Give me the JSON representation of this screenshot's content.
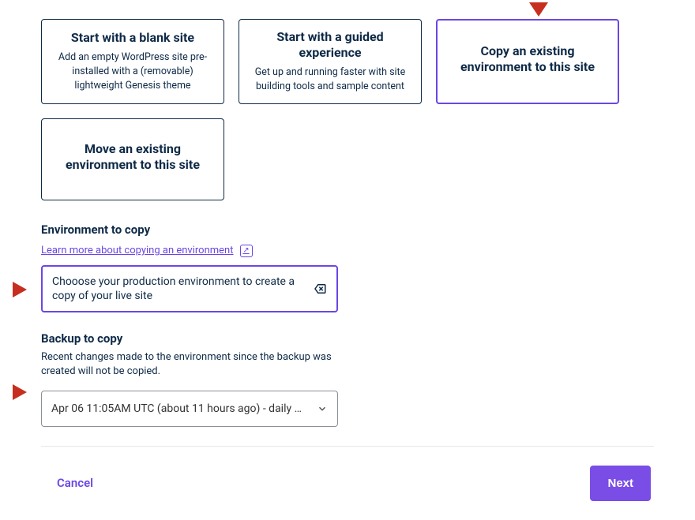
{
  "cards": {
    "blank": {
      "title": "Start with a blank site",
      "desc": "Add an empty WordPress site pre-installed with a (removable) lightweight Genesis theme"
    },
    "guided": {
      "title": "Start with a guided experience",
      "desc": "Get up and running faster with site building tools and sample content"
    },
    "copy": {
      "title": "Copy an existing environment to this site",
      "desc": ""
    },
    "move": {
      "title": "Move an existing environment to this site",
      "desc": ""
    }
  },
  "env_section": {
    "title": "Environment to copy",
    "link_text": "Learn more about copying an environment",
    "input_value": "Chooose your production environment to create a copy of your live site"
  },
  "backup_section": {
    "title": "Backup to copy",
    "helper": "Recent changes made to the environment since the backup was created will not be copied.",
    "selected": "Apr 06 11:05AM UTC (about 11 hours ago) - daily …"
  },
  "footer": {
    "cancel": "Cancel",
    "next": "Next"
  }
}
